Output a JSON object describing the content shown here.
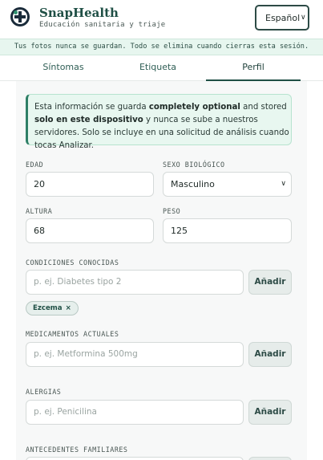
{
  "header": {
    "brand": "SnapHealth",
    "tagline": "Educación sanitaria y triaje",
    "language": "Español"
  },
  "banner": "Tus fotos nunca se guardan. Todo se elimina cuando cierras esta sesión.",
  "tabs": [
    {
      "label": "Síntomas",
      "active": false
    },
    {
      "label": "Etiqueta",
      "active": false
    },
    {
      "label": "Perfil",
      "active": true
    }
  ],
  "info": {
    "p1": "Esta información se guarda ",
    "b1": "completely optional",
    "p2": " and stored ",
    "b2": "solo en este dispositivo",
    "p3": " y nunca se sube a nuestros servidores. Solo se incluye en una solicitud de análisis cuando tocas Analizar."
  },
  "form": {
    "age": {
      "label": "EDAD",
      "value": "20"
    },
    "sex": {
      "label": "SEXO BIOLÓGICO",
      "value": "Masculino"
    },
    "height": {
      "label": "ALTURA",
      "value": "68"
    },
    "weight": {
      "label": "PESO",
      "value": "125"
    },
    "conditions": {
      "label": "CONDICIONES CONOCIDAS",
      "placeholder": "p. ej. Diabetes tipo 2",
      "add_label": "Añadir",
      "chips": [
        "Ezcema"
      ]
    },
    "medications": {
      "label": "MEDICAMENTOS ACTUALES",
      "placeholder": "p. ej. Metformina 500mg",
      "add_label": "Añadir"
    },
    "allergies": {
      "label": "ALERGIAS",
      "placeholder": "p. ej. Penicilina",
      "add_label": "Añadir"
    },
    "family_history": {
      "label": "ANTECEDENTES FAMILIARES"
    }
  },
  "icons": {
    "logo": "medical-cross-icon",
    "caret": "chevron-down-icon",
    "remove": "close-icon"
  },
  "colors": {
    "brand": "#1f4f45",
    "banner_bg": "#e7f6ef",
    "info_accent": "#2e7f66"
  }
}
